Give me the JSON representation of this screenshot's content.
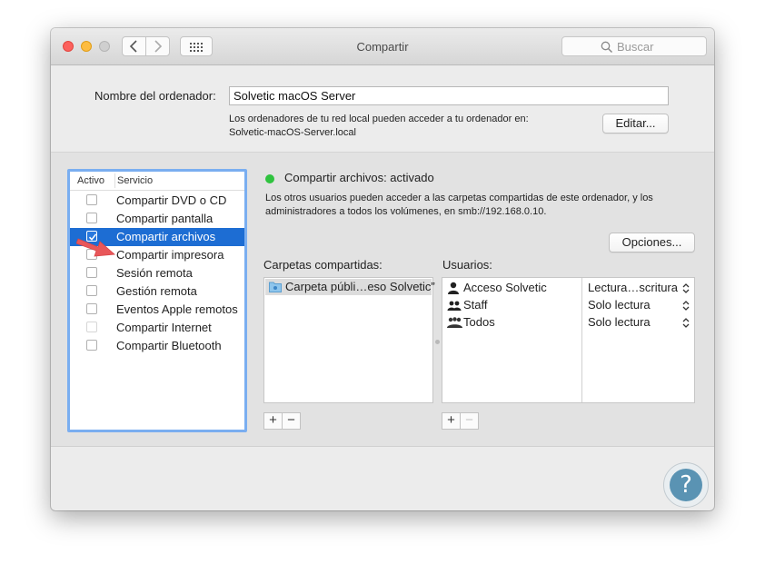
{
  "window": {
    "title": "Compartir"
  },
  "search": {
    "placeholder": "Buscar"
  },
  "computer_name": {
    "label": "Nombre del ordenador:",
    "value": "Solvetic macOS Server",
    "help_line1": "Los ordenadores de tu red local pueden acceder a tu ordenador en:",
    "help_line2": "Solvetic-macOS-Server.local",
    "edit_button": "Editar..."
  },
  "services": {
    "header_active": "Activo",
    "header_service": "Servicio",
    "items": [
      {
        "label": "Compartir DVD o CD",
        "checked": false
      },
      {
        "label": "Compartir pantalla",
        "checked": false
      },
      {
        "label": "Compartir archivos",
        "checked": true,
        "selected": true
      },
      {
        "label": "Compartir impresora",
        "checked": false
      },
      {
        "label": "Sesión remota",
        "checked": false
      },
      {
        "label": "Gestión remota",
        "checked": false
      },
      {
        "label": "Eventos Apple remotos",
        "checked": false
      },
      {
        "label": "Compartir Internet",
        "checked": false
      },
      {
        "label": "Compartir Bluetooth",
        "checked": false
      }
    ]
  },
  "status": {
    "title": "Compartir archivos: activado",
    "color": "#2fc33f",
    "desc_line1": "Los otros usuarios pueden acceder a las carpetas compartidas de este ordenador, y los",
    "desc_line2": "administradores a todos los volúmenes, en smb://192.168.0.10."
  },
  "options_button": "Opciones...",
  "shared_folders": {
    "label": "Carpetas compartidas:",
    "items": [
      "Carpeta públi…eso Solvetic”"
    ]
  },
  "users": {
    "label": "Usuarios:",
    "items": [
      {
        "name": "Acceso Solvetic",
        "permission": "Lectura…scritura",
        "icon": "single-user-icon"
      },
      {
        "name": "Staff",
        "permission": "Solo lectura",
        "icon": "group-icon"
      },
      {
        "name": "Todos",
        "permission": "Solo lectura",
        "icon": "everyone-icon"
      }
    ]
  },
  "buttons": {
    "add": "+",
    "remove": "−"
  },
  "help_button": "?"
}
